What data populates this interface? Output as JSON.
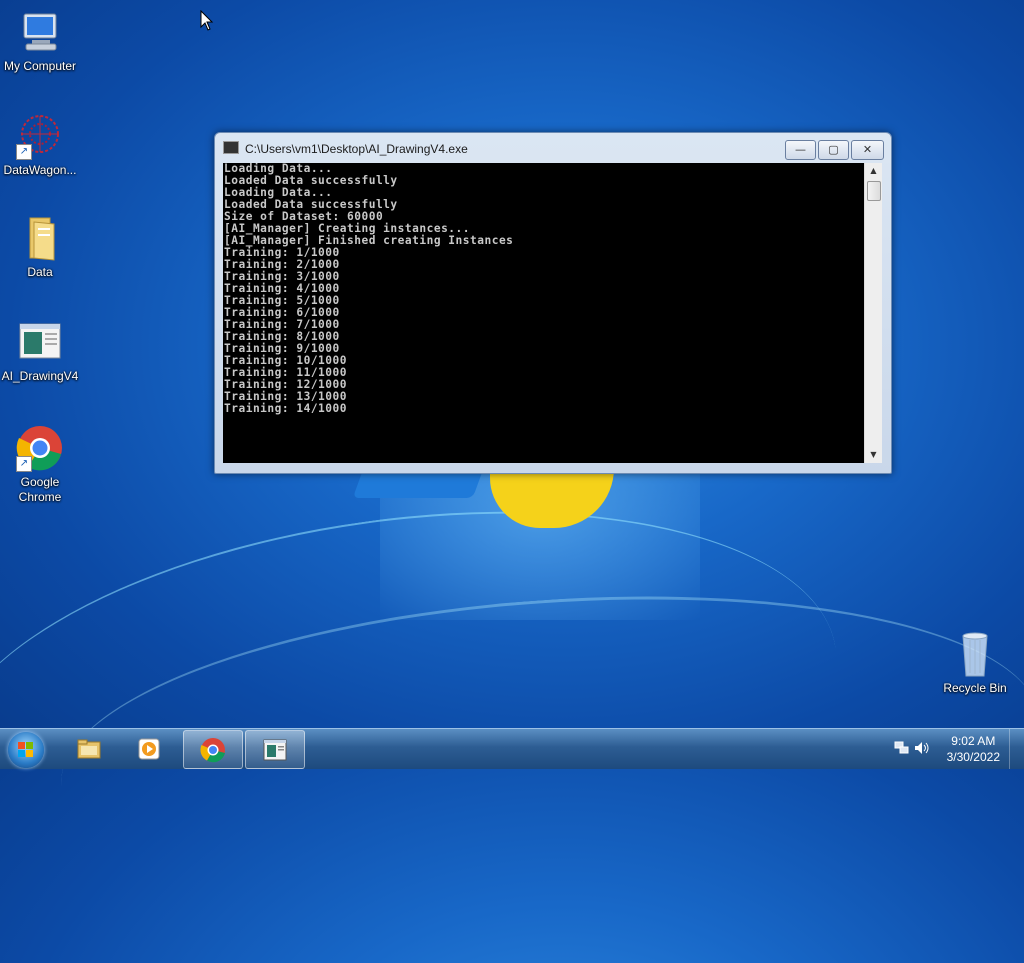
{
  "desktop": {
    "icons": [
      {
        "label": "My Computer",
        "icon": "computer-icon"
      },
      {
        "label": "DataWagon...",
        "icon": "datawagon-icon"
      },
      {
        "label": "Data",
        "icon": "folder-icon"
      },
      {
        "label": "AI_DrawingV4",
        "icon": "app-window-icon"
      },
      {
        "label": "Google Chrome",
        "icon": "chrome-icon"
      },
      {
        "label": "Recycle Bin",
        "icon": "recycle-bin-icon"
      }
    ]
  },
  "console_window": {
    "title": "C:\\Users\\vm1\\Desktop\\AI_DrawingV4.exe",
    "buttons": {
      "minimize": "—",
      "maximize": "▢",
      "close": "✕"
    },
    "output": "Loading Data...\nLoaded Data successfully\nLoading Data...\nLoaded Data successfully\nSize of Dataset: 60000\n[AI_Manager] Creating instances...\n[AI_Manager] Finished creating Instances\nTraining: 1/1000\nTraining: 2/1000\nTraining: 3/1000\nTraining: 4/1000\nTraining: 5/1000\nTraining: 6/1000\nTraining: 7/1000\nTraining: 8/1000\nTraining: 9/1000\nTraining: 10/1000\nTraining: 11/1000\nTraining: 12/1000\nTraining: 13/1000\nTraining: 14/1000"
  },
  "taskbar": {
    "items": [
      "start-button",
      "explorer",
      "media-player",
      "google-chrome",
      "ai-drawing-console"
    ],
    "clock": {
      "time": "9:02 AM",
      "date": "3/30/2022"
    }
  },
  "colors": {
    "console_bg": "#000000",
    "console_fg": "#c8c8c8",
    "desktop": "#1868c8"
  }
}
